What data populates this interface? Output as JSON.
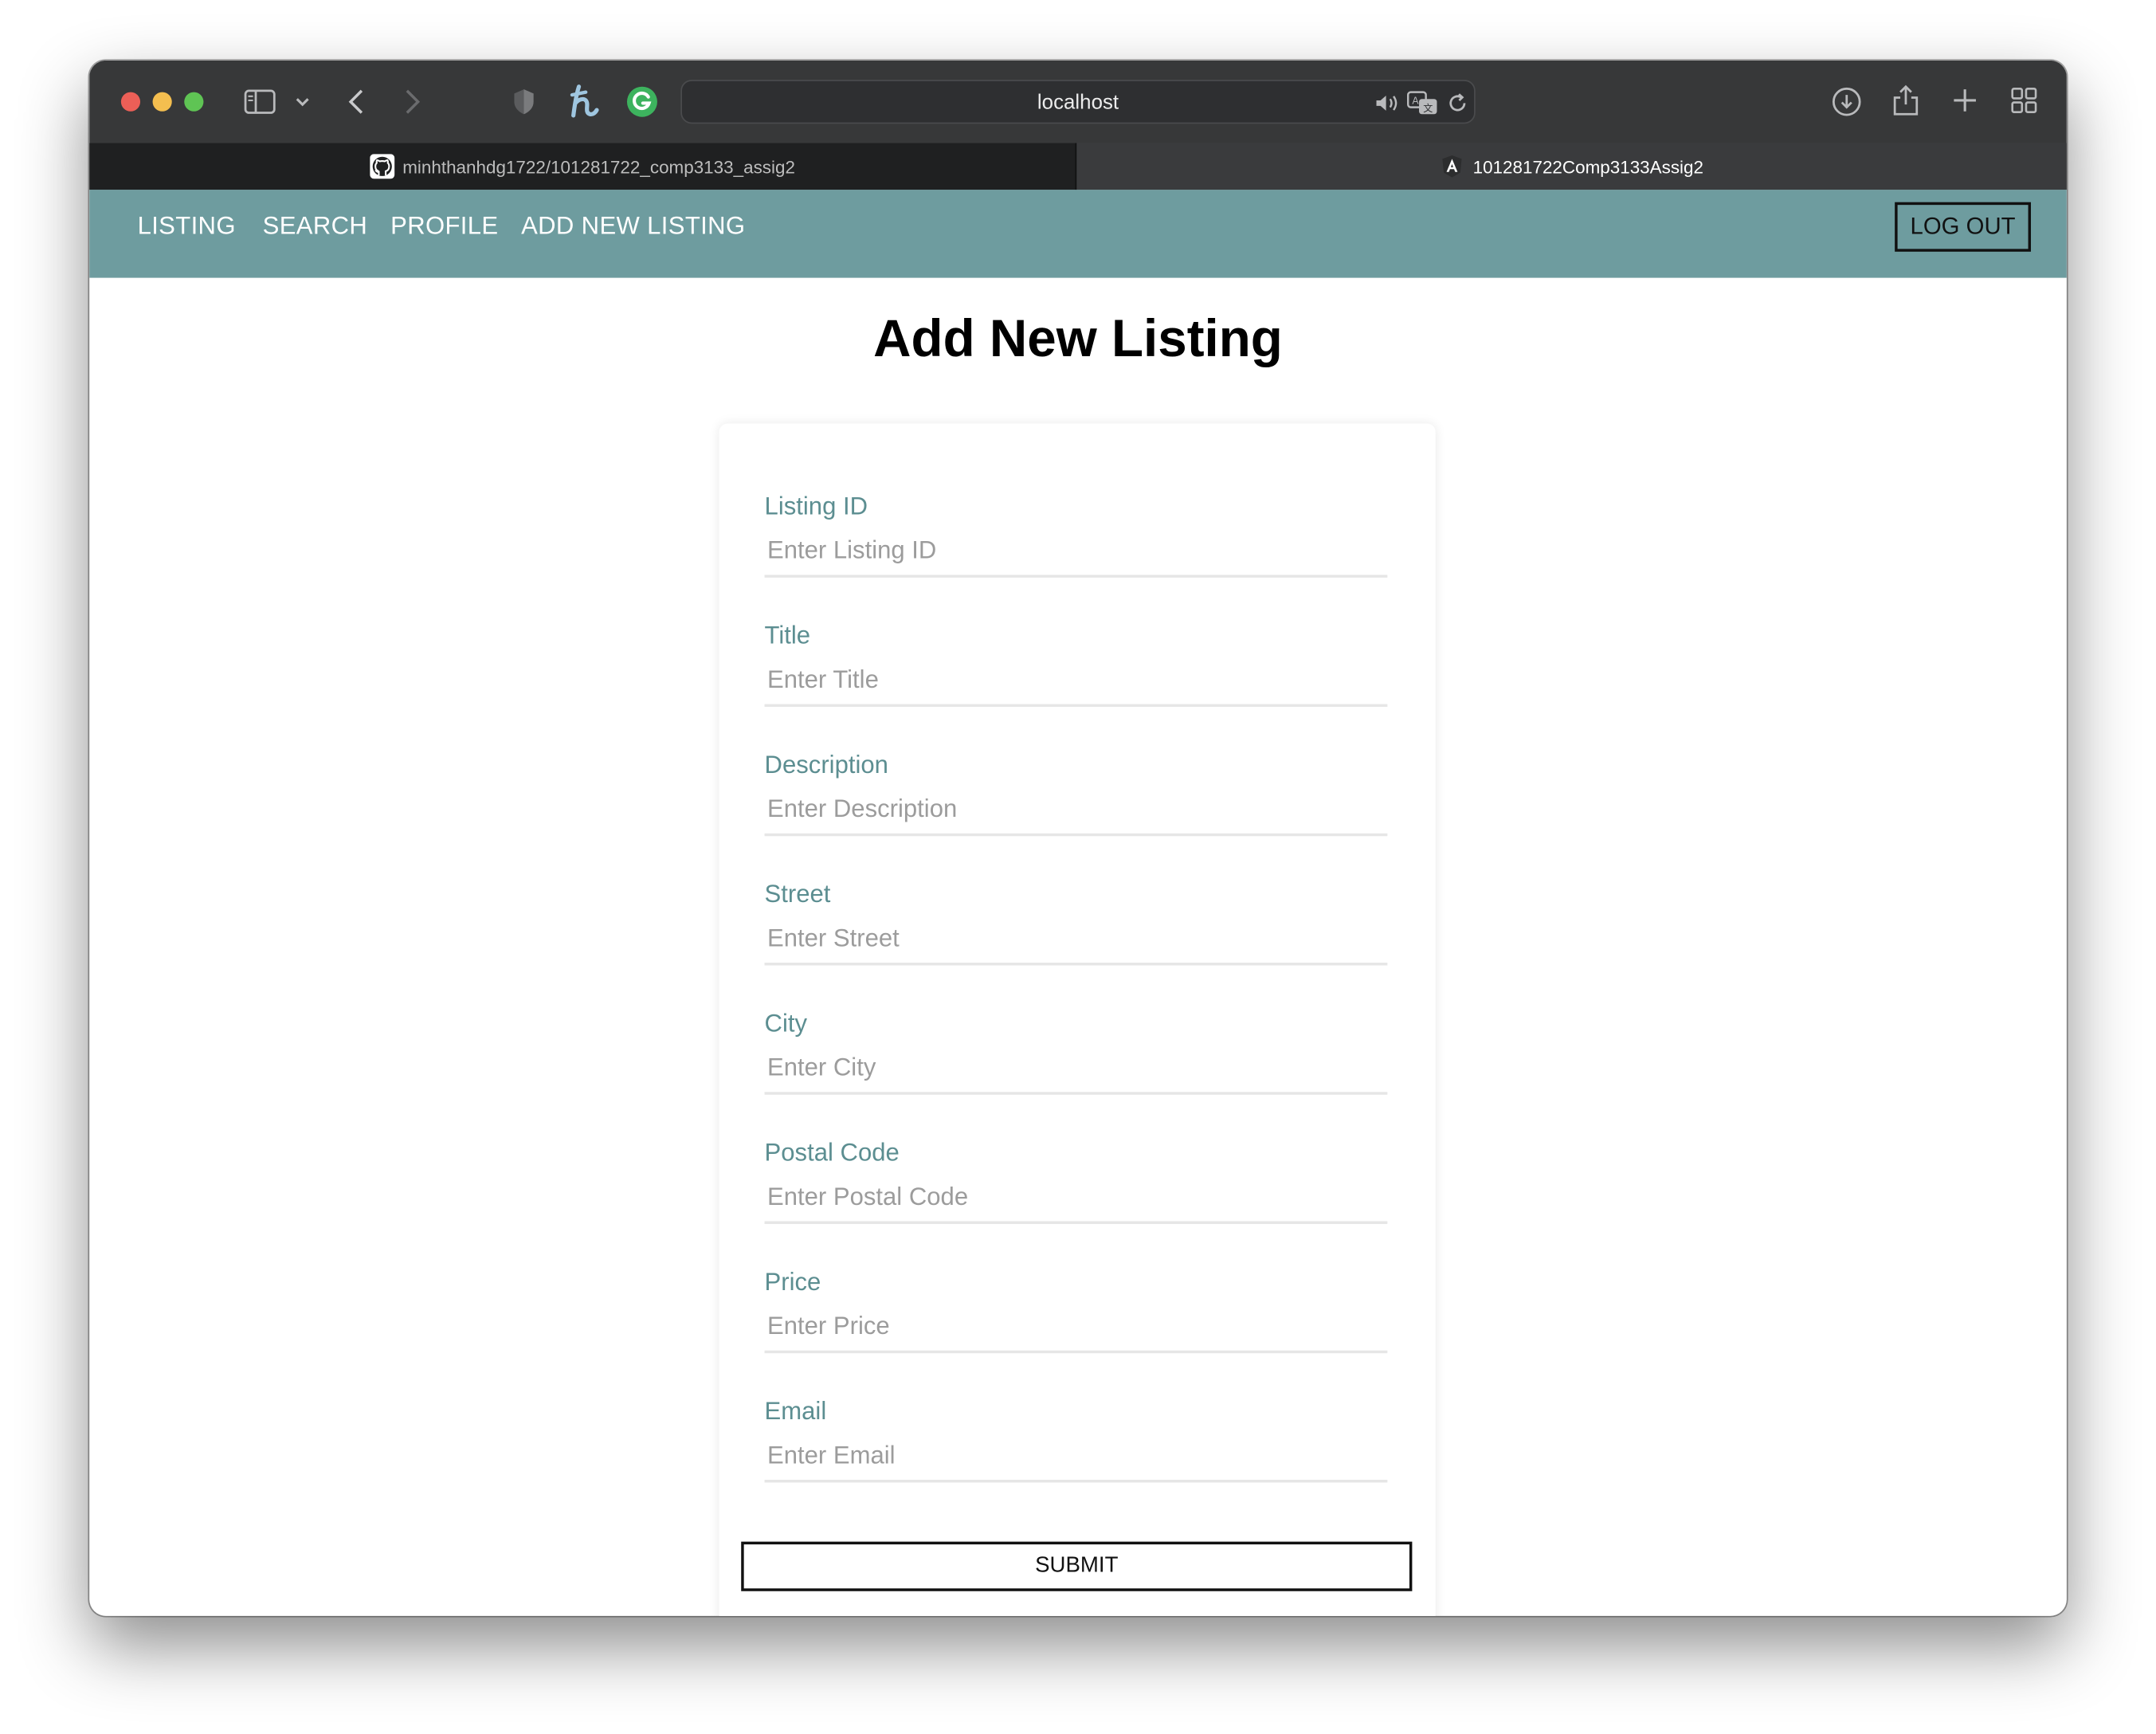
{
  "browser": {
    "address": "localhost",
    "tabs": [
      {
        "label": "minhthanhdg1722/101281722_comp3133_assig2",
        "icon": "github-icon"
      },
      {
        "label": "101281722Comp3133Assig2",
        "icon": "angular-icon"
      }
    ],
    "colors": {
      "traffic_close": "#ec5f57",
      "traffic_min": "#f4be4f",
      "traffic_max": "#5fc454",
      "grammarly": "#3db35e"
    }
  },
  "nav": {
    "links": [
      "LISTING",
      "SEARCH",
      "PROFILE",
      "ADD NEW LISTING"
    ],
    "logout_label": "LOG OUT",
    "color": "#6e9c9f"
  },
  "page": {
    "title": "Add New Listing"
  },
  "form": {
    "fields": [
      {
        "label": "Listing ID",
        "placeholder": "Enter Listing ID"
      },
      {
        "label": "Title",
        "placeholder": "Enter Title"
      },
      {
        "label": "Description",
        "placeholder": "Enter Description"
      },
      {
        "label": "Street",
        "placeholder": "Enter Street"
      },
      {
        "label": "City",
        "placeholder": "Enter City"
      },
      {
        "label": "Postal Code",
        "placeholder": "Enter Postal Code"
      },
      {
        "label": "Price",
        "placeholder": "Enter Price"
      },
      {
        "label": "Email",
        "placeholder": "Enter Email"
      }
    ],
    "submit_label": "SUBMIT"
  }
}
